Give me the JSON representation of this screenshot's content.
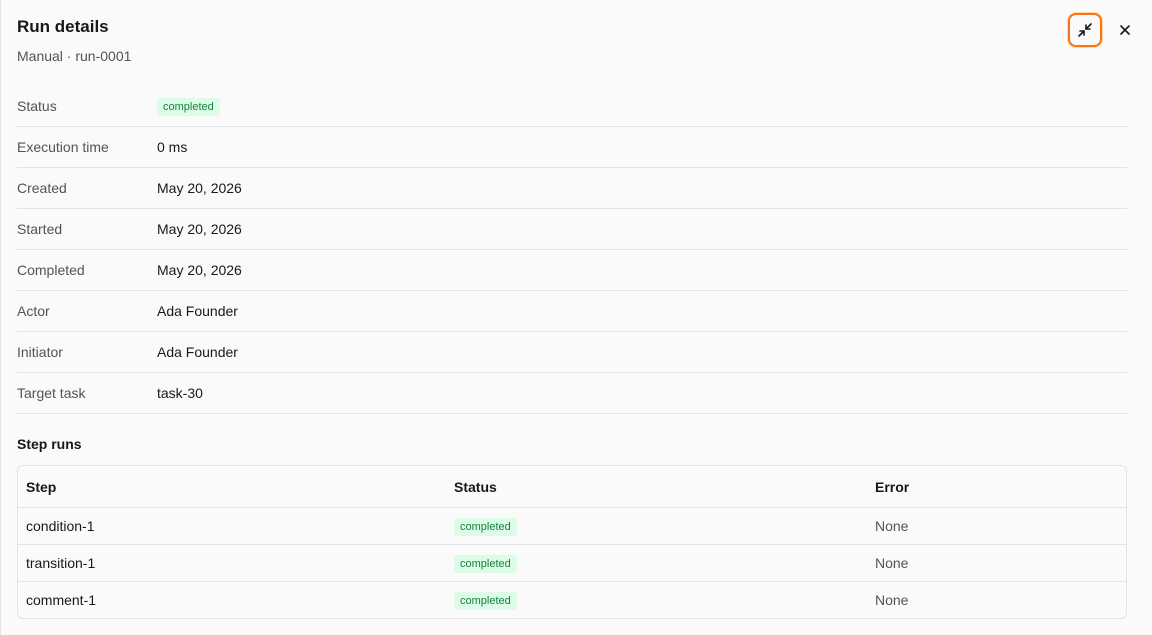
{
  "header": {
    "title": "Run details",
    "subtitle": "Manual · run-0001"
  },
  "icons": {
    "collapse": "minimize-icon",
    "close": "close-icon"
  },
  "colors": {
    "accent_focus": "#f97316",
    "badge_bg": "#dcfce7",
    "badge_text": "#15803d"
  },
  "details": {
    "status": {
      "label": "Status",
      "value": "completed"
    },
    "execution_time": {
      "label": "Execution time",
      "value": "0 ms"
    },
    "created": {
      "label": "Created",
      "value": "May 20, 2026"
    },
    "started": {
      "label": "Started",
      "value": "May 20, 2026"
    },
    "completed": {
      "label": "Completed",
      "value": "May 20, 2026"
    },
    "actor": {
      "label": "Actor",
      "value": "Ada Founder"
    },
    "initiator": {
      "label": "Initiator",
      "value": "Ada Founder"
    },
    "target_task": {
      "label": "Target task",
      "value": "task-30"
    }
  },
  "step_runs": {
    "title": "Step runs",
    "columns": [
      "Step",
      "Status",
      "Error"
    ],
    "rows": [
      {
        "step": "condition-1",
        "status": "completed",
        "error": "None"
      },
      {
        "step": "transition-1",
        "status": "completed",
        "error": "None"
      },
      {
        "step": "comment-1",
        "status": "completed",
        "error": "None"
      }
    ]
  }
}
